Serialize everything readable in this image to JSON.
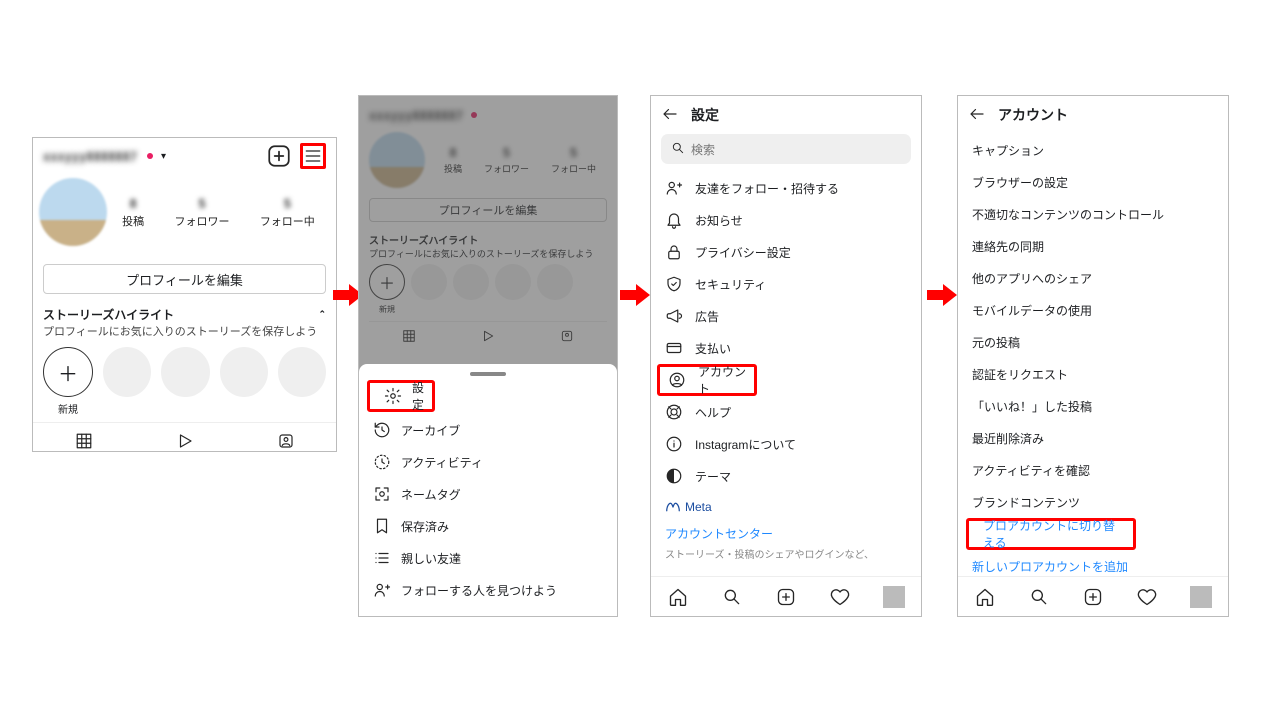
{
  "screen1": {
    "username_blurred": "xxxyyy8888887",
    "stats": [
      {
        "label": "投稿"
      },
      {
        "label": "フォロワー"
      },
      {
        "label": "フォロー中"
      }
    ],
    "edit_profile": "プロフィールを編集",
    "story_title": "ストーリーズハイライト",
    "story_sub": "プロフィールにお気に入りのストーリーズを保存しよう",
    "story_new": "新規"
  },
  "screen2": {
    "menu": [
      {
        "icon": "gear",
        "label": "設定",
        "highlighted": true
      },
      {
        "icon": "history",
        "label": "アーカイブ"
      },
      {
        "icon": "activity",
        "label": "アクティビティ"
      },
      {
        "icon": "nametag",
        "label": "ネームタグ"
      },
      {
        "icon": "bookmark",
        "label": "保存済み"
      },
      {
        "icon": "list",
        "label": "親しい友達"
      },
      {
        "icon": "person-plus",
        "label": "フォローする人を見つけよう"
      }
    ]
  },
  "screen3": {
    "title": "設定",
    "search_placeholder": "検索",
    "items": [
      {
        "icon": "person-plus",
        "label": "友達をフォロー・招待する"
      },
      {
        "icon": "bell",
        "label": "お知らせ"
      },
      {
        "icon": "lock",
        "label": "プライバシー設定"
      },
      {
        "icon": "shield",
        "label": "セキュリティ"
      },
      {
        "icon": "megaphone",
        "label": "広告"
      },
      {
        "icon": "card",
        "label": "支払い"
      },
      {
        "icon": "account",
        "label": "アカウント",
        "highlighted": true
      },
      {
        "icon": "help",
        "label": "ヘルプ"
      },
      {
        "icon": "info",
        "label": "Instagramについて"
      },
      {
        "icon": "theme",
        "label": "テーマ"
      }
    ],
    "meta": "Meta",
    "account_center": "アカウントセンター",
    "meta_sub": "ストーリーズ・投稿のシェアやログインなど、"
  },
  "screen4": {
    "title": "アカウント",
    "items": [
      "キャプション",
      "ブラウザーの設定",
      "不適切なコンテンツのコントロール",
      "連絡先の同期",
      "他のアプリへのシェア",
      "モバイルデータの使用",
      "元の投稿",
      "認証をリクエスト",
      "「いいね！」した投稿",
      "最近削除済み",
      "アクティビティを確認",
      "ブランドコンテンツ"
    ],
    "switch_pro": "プロアカウントに切り替える",
    "add_pro": "新しいプロアカウントを追加"
  }
}
